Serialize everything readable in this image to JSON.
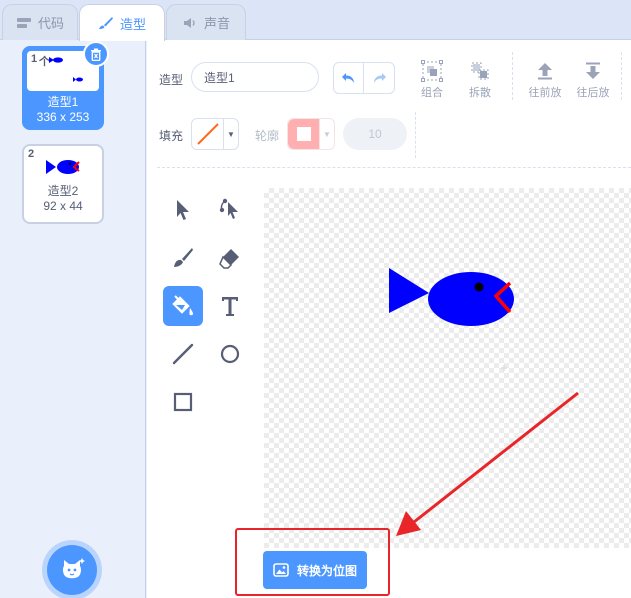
{
  "tabs": [
    {
      "label": "代码",
      "icon": "code-blocks-icon",
      "active": false
    },
    {
      "label": "造型",
      "icon": "paintbrush-icon",
      "active": true
    },
    {
      "label": "声音",
      "icon": "speaker-icon",
      "active": false
    }
  ],
  "costumes": [
    {
      "number": "1",
      "thumb_text": "个",
      "name": "造型1",
      "size": "336 x 253",
      "selected": true
    },
    {
      "number": "2",
      "name": "造型2",
      "size": "92 x 44",
      "selected": false
    }
  ],
  "toolbar": {
    "costume_label": "造型",
    "costume_name": "造型1",
    "group_label": "组合",
    "ungroup_label": "拆散",
    "forward_label": "往前放",
    "backward_label": "往后放",
    "fill_label": "填充",
    "outline_label": "轮廓",
    "outline_width": "10"
  },
  "convert_button": "转换为位图",
  "colors": {
    "accent": "#4c97ff",
    "fish_body": "#0000ff",
    "fish_mouth": "#ff0000",
    "annotation": "#e8262a"
  }
}
